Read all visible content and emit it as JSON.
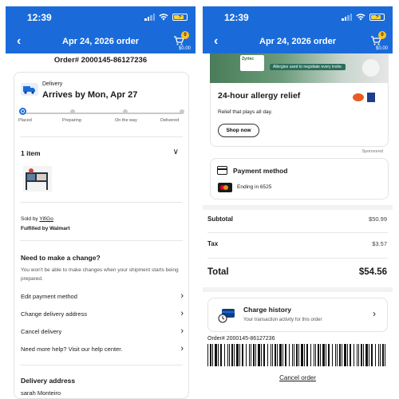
{
  "status_bar": {
    "time": "12:39"
  },
  "nav": {
    "title": "Apr 24, 2026 order",
    "cart_count": "0",
    "cart_total": "$0.00"
  },
  "left": {
    "order_number": "Order# 2000145-86127236",
    "delivery_label": "Delivery",
    "arrives": "Arrives by Mon, Apr 27",
    "steps": [
      "Placed",
      "Preparing",
      "On the way",
      "Delivered"
    ],
    "current_step": 0,
    "item_count": "1 item",
    "sold_by_prefix": "Sold by",
    "seller": "YifiGo",
    "fulfilled_by": "Fulfilled by Walmart",
    "change_title": "Need to make a change?",
    "change_desc": "You won't be able to make changes when your shipment starts being prepared.",
    "actions": [
      "Edit payment method",
      "Change delivery address",
      "Cancel delivery",
      "Need more help? Visit our help center."
    ],
    "address_title": "Delivery address",
    "address_name": "sarah Monteiro"
  },
  "right": {
    "ad": {
      "box_text": "Zyrtec",
      "banner_text": "Allergies used to negotiate every invite.",
      "headline": "24-hour allergy relief",
      "subtext": "Relief that plays all day.",
      "cta": "Shop now",
      "sponsored": "Sponsored"
    },
    "payment": {
      "title": "Payment method",
      "ending": "Ending in 6525"
    },
    "summary": {
      "subtotal_label": "Subtotal",
      "subtotal": "$50.99",
      "tax_label": "Tax",
      "tax": "$3.57",
      "total_label": "Total",
      "total": "$54.56"
    },
    "charge_history": {
      "title": "Charge history",
      "subtitle": "Your transaction activity for this order"
    },
    "barcode_number": "Order# 2000145-86127236",
    "cancel_order": "Cancel order"
  },
  "colors": {
    "brand_blue": "#1a6bd9",
    "badge_yellow": "#ffc220"
  },
  "icons": [
    "back-chevron-icon",
    "cart-icon",
    "truck-icon",
    "chevron-down-icon",
    "chevron-right-icon",
    "card-icon",
    "mastercard-icon",
    "charge-history-icon"
  ]
}
